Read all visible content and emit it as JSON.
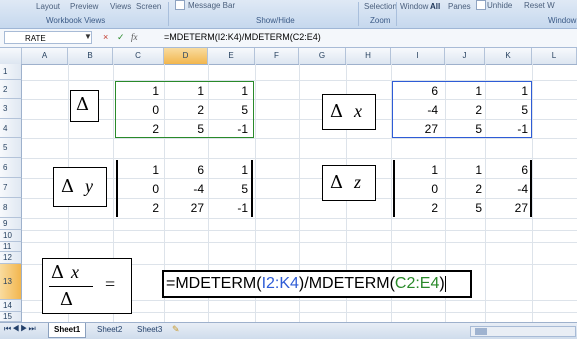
{
  "ribbon": {
    "tabs": {
      "layout": "Layout",
      "preview": "Preview",
      "views": "Views",
      "screen": "Screen",
      "message_bar": "Message Bar",
      "selection": "Selection",
      "window": "Window",
      "all": "All",
      "panes": "Panes",
      "unhide": "Unhide",
      "reset": "Reset W"
    },
    "groups": {
      "workbook_views": "Workbook Views",
      "show_hide": "Show/Hide",
      "zoom": "Zoom",
      "window": "Window"
    }
  },
  "formula_bar": {
    "name_box": "RATE",
    "cancel_icon": "×",
    "enter_icon": "✓",
    "fx_label": "fx",
    "formula": "=MDETERM(I2:K4)/MDETERM(C2:E4)"
  },
  "columns": [
    "A",
    "B",
    "C",
    "D",
    "E",
    "F",
    "G",
    "H",
    "I",
    "J",
    "K",
    "L"
  ],
  "rows": [
    "1",
    "2",
    "3",
    "4",
    "5",
    "6",
    "7",
    "8",
    "9",
    "10",
    "11",
    "12",
    "13",
    "14",
    "15"
  ],
  "matrix_delta": [
    [
      "1",
      "1",
      "1"
    ],
    [
      "0",
      "2",
      "5"
    ],
    [
      "2",
      "5",
      "-1"
    ]
  ],
  "matrix_delta_x": [
    [
      "6",
      "1",
      "1"
    ],
    [
      "-4",
      "2",
      "5"
    ],
    [
      "27",
      "5",
      "-1"
    ]
  ],
  "matrix_delta_y": [
    [
      "1",
      "6",
      "1"
    ],
    [
      "0",
      "-4",
      "5"
    ],
    [
      "2",
      "27",
      "-1"
    ]
  ],
  "matrix_delta_z": [
    [
      "1",
      "1",
      "6"
    ],
    [
      "0",
      "2",
      "-4"
    ],
    [
      "2",
      "5",
      "27"
    ]
  ],
  "labels": {
    "delta": "Δ",
    "x": "x",
    "y": "y",
    "z": "z",
    "equals": "="
  },
  "cell_formula": {
    "prefix": "=MDETERM(",
    "ref1": "I2:K4",
    "middle": ")/MDETERM(",
    "ref2": "C2:E4",
    "suffix": ")"
  },
  "sheet_tabs": [
    "Sheet1",
    "Sheet2",
    "Sheet3"
  ],
  "colors": {
    "ref1": "#2e5cd6",
    "ref2": "#2a8a2a"
  }
}
